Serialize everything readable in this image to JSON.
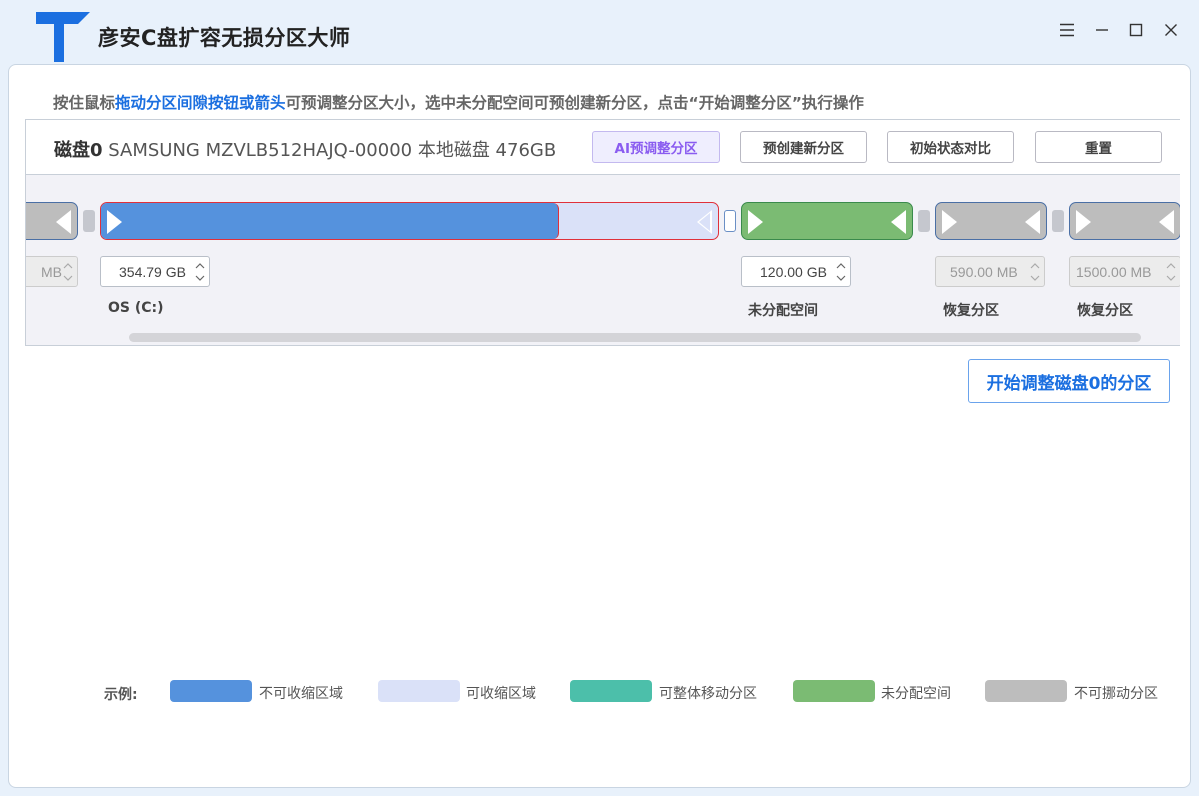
{
  "app": {
    "title": "彦安C盘扩容无损分区大师"
  },
  "hint": {
    "part1": "按住鼠标",
    "part2": "拖动分区间隙按钮或箭头",
    "part3": "可预调整分区大小，选中未分配空间可预创建新分区，点击“开始调整分区”执行操作"
  },
  "disk": {
    "name": "磁盘0",
    "model": "SAMSUNG MZVLB512HAJQ-00000 本地磁盘 476GB",
    "buttons": {
      "ai_adjust": "AI预调整分区",
      "create": "预创建新分区",
      "compare": "初始状态对比",
      "reset": "重置"
    }
  },
  "partitions": [
    {
      "size": "MB",
      "label": "",
      "type": "immovable"
    },
    {
      "size": "354.79 GB",
      "label": "OS (C:)",
      "type": "resizable"
    },
    {
      "size": "120.00 GB",
      "label": "未分配空间",
      "type": "unallocated"
    },
    {
      "size": "590.00 MB",
      "label": "恢复分区",
      "type": "immovable"
    },
    {
      "size": "1500.00 MB",
      "label": "恢复分区",
      "type": "immovable"
    }
  ],
  "start_button": "开始调整磁盘0的分区",
  "legend": {
    "title": "示例:",
    "items": [
      {
        "label": "不可收缩区域",
        "color": "#5592dd"
      },
      {
        "label": "可收缩区域",
        "color": "#dae1f8"
      },
      {
        "label": "可整体移动分区",
        "color": "#4cbfaa"
      },
      {
        "label": "未分配空间",
        "color": "#7bbb73"
      },
      {
        "label": "不可挪动分区",
        "color": "#bdbdbd"
      }
    ]
  },
  "colors": {
    "accent": "#1b6fe0",
    "used": "#5592dd",
    "shrinkable": "#dae1f8",
    "unallocated": "#7bbb73",
    "immovable": "#bdbdbd",
    "selected_border": "#e0303a"
  }
}
